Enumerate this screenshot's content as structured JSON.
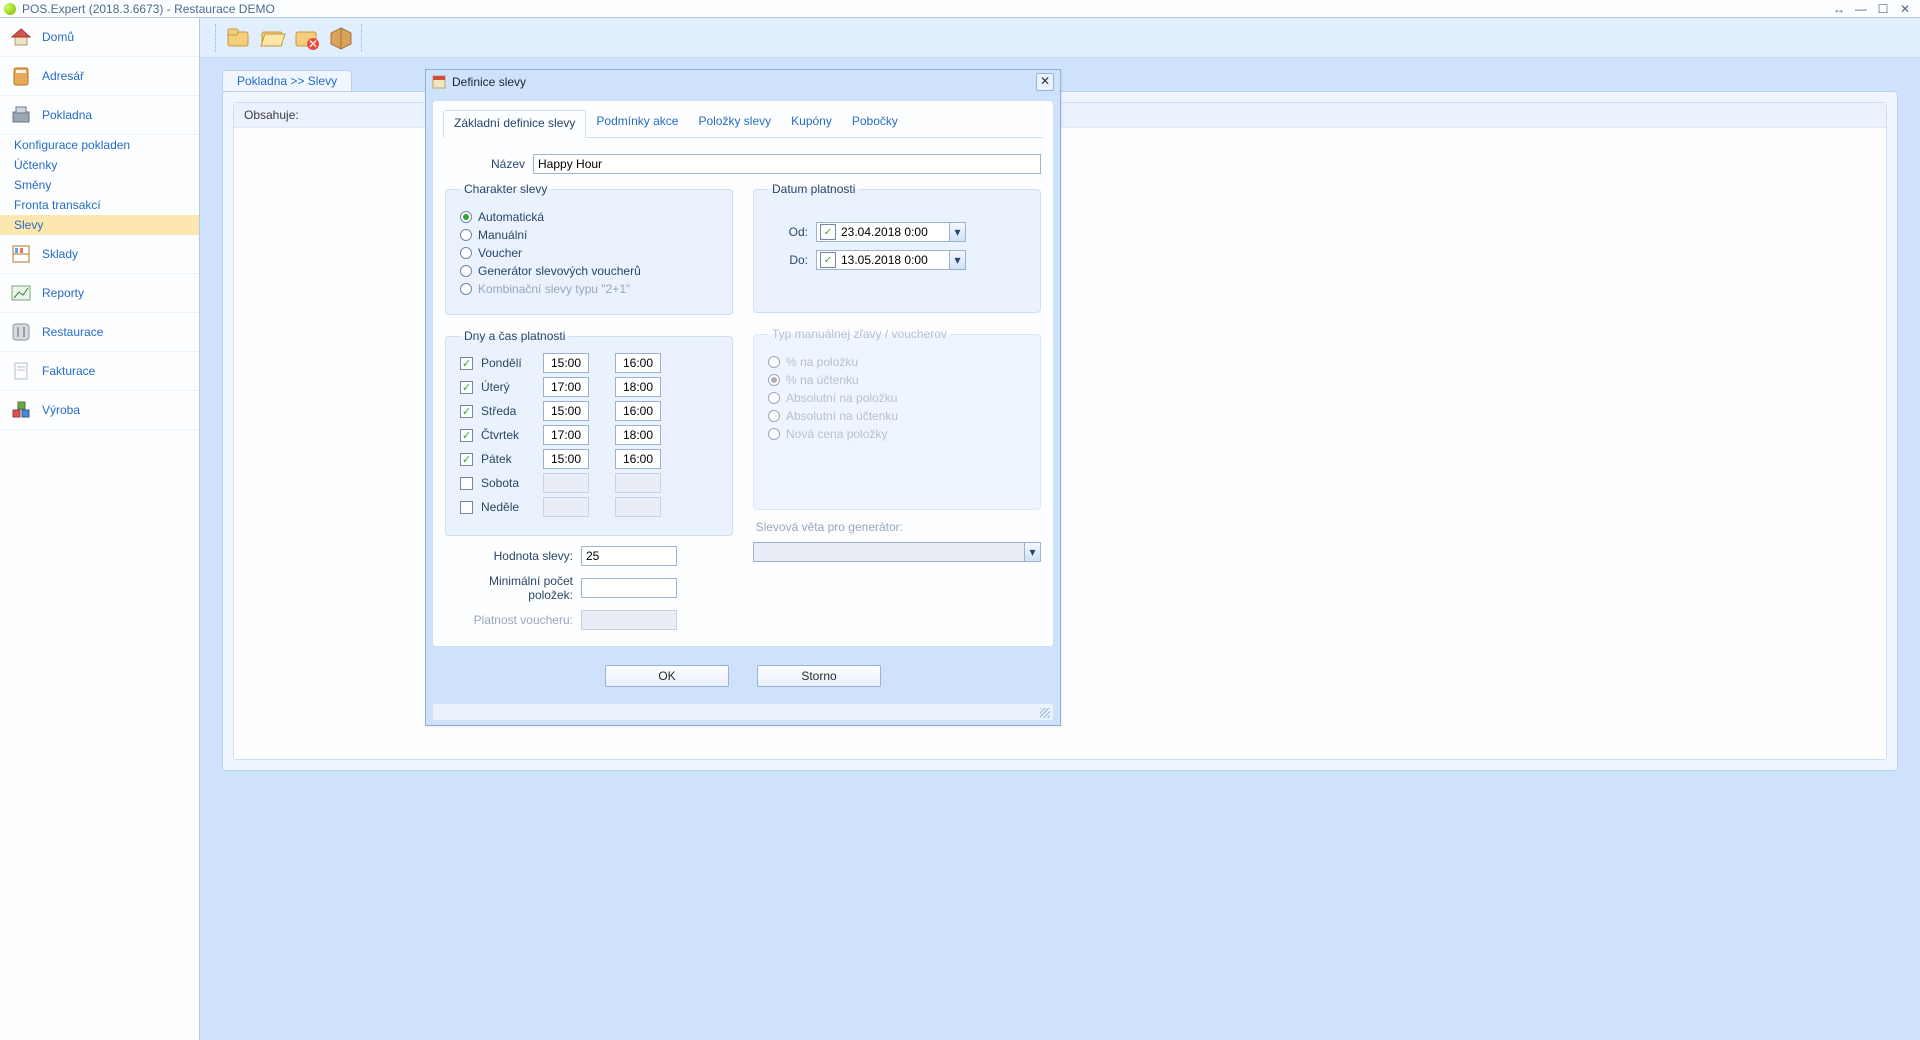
{
  "titlebar": {
    "text": "POS.Expert (2018.3.6673) - Restaurace DEMO"
  },
  "sidebar": {
    "items": [
      {
        "label": "Domů",
        "icon": "home"
      },
      {
        "label": "Adresář",
        "icon": "book"
      },
      {
        "label": "Pokladna",
        "icon": "register",
        "children": [
          {
            "label": "Konfigurace pokladen"
          },
          {
            "label": "Účtenky"
          },
          {
            "label": "Směny"
          },
          {
            "label": "Fronta transakcí"
          },
          {
            "label": "Slevy",
            "active": true
          }
        ]
      },
      {
        "label": "Sklady",
        "icon": "shelf"
      },
      {
        "label": "Reporty",
        "icon": "chart"
      },
      {
        "label": "Restaurace",
        "icon": "cutlery"
      },
      {
        "label": "Fakturace",
        "icon": "invoice"
      },
      {
        "label": "Výroba",
        "icon": "blocks"
      }
    ]
  },
  "breadcrumb": "Pokladna >> Slevy",
  "panel": {
    "contains_label": "Obsahuje:"
  },
  "dialog": {
    "title": "Definice slevy",
    "tabs": [
      "Základní definice slevy",
      "Podmínky akce",
      "Položky slevy",
      "Kupóny",
      "Pobočky"
    ],
    "active_tab": 0,
    "name_label": "Název",
    "name_value": "Happy Hour",
    "charakter": {
      "legend": "Charakter slevy",
      "options": [
        "Automatická",
        "Manuální",
        "Voucher",
        "Generátor slevových voucherů",
        "Kombinační slevy typu \"2+1\""
      ],
      "selected": 0,
      "disabled_index": 4
    },
    "datum": {
      "legend": "Datum platnosti",
      "od_label": "Od:",
      "od_value": "23.04.2018 0:00",
      "do_label": "Do:",
      "do_value": "13.05.2018 0:00"
    },
    "dny": {
      "legend": "Dny a čas platnosti",
      "rows": [
        {
          "day": "Pondělí",
          "on": true,
          "from": "15:00",
          "to": "16:00"
        },
        {
          "day": "Úterý",
          "on": true,
          "from": "17:00",
          "to": "18:00"
        },
        {
          "day": "Středa",
          "on": true,
          "from": "15:00",
          "to": "16:00"
        },
        {
          "day": "Čtvrtek",
          "on": true,
          "from": "17:00",
          "to": "18:00"
        },
        {
          "day": "Pátek",
          "on": true,
          "from": "15:00",
          "to": "16:00"
        },
        {
          "day": "Sobota",
          "on": false,
          "from": "",
          "to": ""
        },
        {
          "day": "Neděle",
          "on": false,
          "from": "",
          "to": ""
        }
      ]
    },
    "typ": {
      "legend": "Typ manuálnej zľavy / voucherov",
      "options": [
        "% na položku",
        "% na účtenku",
        "Absolutní na položku",
        "Absolutní na účtenku",
        "Nová cena položky"
      ],
      "selected": 1
    },
    "hodnota_label": "Hodnota slevy:",
    "hodnota_value": "25",
    "min_label": "Minimální počet položek:",
    "min_value": "",
    "platnost_label": "Platnost voucheru:",
    "gen_label": "Slevová věta pro generátor:",
    "ok": "OK",
    "storno": "Storno"
  }
}
